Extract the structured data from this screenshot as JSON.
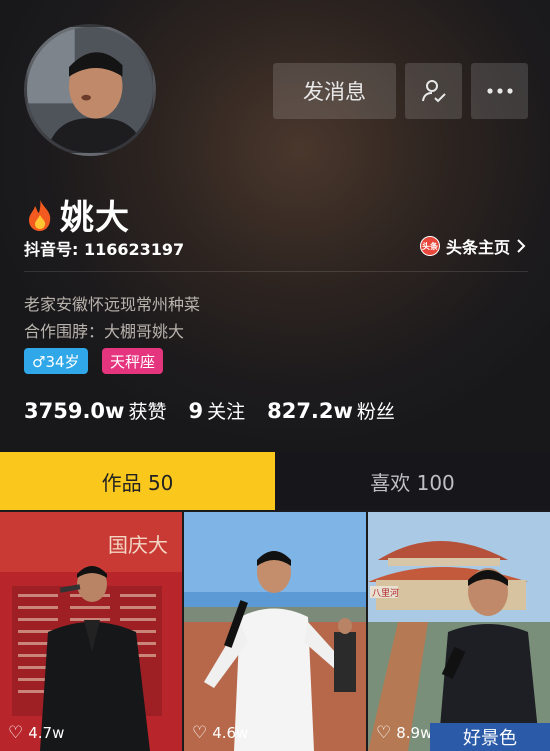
{
  "profile": {
    "name": "姚大",
    "douyin_id": "抖音号: 116623197",
    "toutiao_label": "头条主页",
    "toutiao_badge": "头条",
    "bio_line1": "老家安徽怀远现常州种菜",
    "bio_line2": "合作围脖：大棚哥姚大",
    "age_tag": "♂34岁",
    "zodiac_tag": "天秤座"
  },
  "actions": {
    "message_label": "发消息"
  },
  "stats": {
    "likes_value": "3759.0w",
    "likes_label": "获赞",
    "following_value": "9",
    "following_label": "关注",
    "fans_value": "827.2w",
    "fans_label": "粉丝"
  },
  "tabs": {
    "works": "作品 50",
    "favorites": "喜欢 100"
  },
  "videos": [
    {
      "likes": "4.7w"
    },
    {
      "likes": "4.6w"
    },
    {
      "likes": "8.9w",
      "caption": "好景色"
    }
  ],
  "thumb_text": {
    "banner": "国庆大",
    "sign": "八里河"
  },
  "colors": {
    "tab_active": "#fac81c",
    "age_tag": "#2fa7e8",
    "zodiac_tag": "#e6357f"
  }
}
